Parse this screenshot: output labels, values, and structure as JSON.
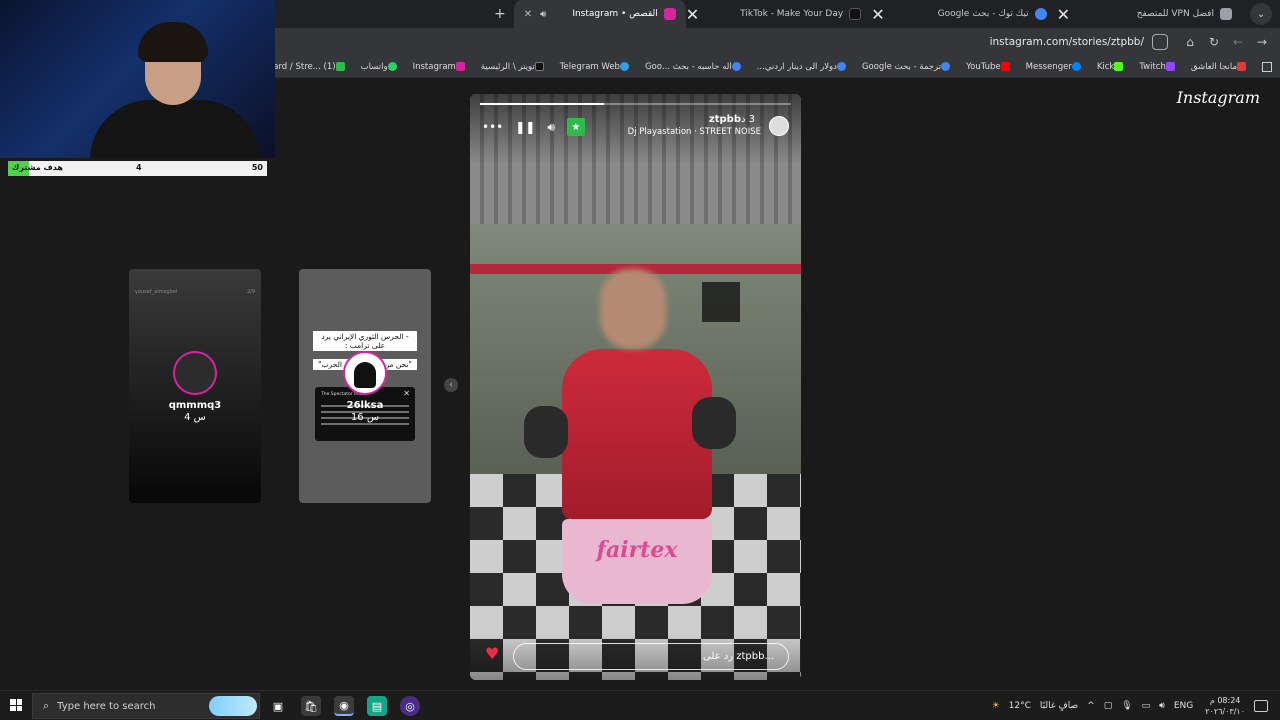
{
  "browser": {
    "tabs": [
      {
        "title": "أفضل VPN للمتصفح",
        "color": "#9aa0a6",
        "active": false
      },
      {
        "title": "تيك توك - بحث Google",
        "color": "#4285f4",
        "active": false
      },
      {
        "title": "TikTok - Make Your Day",
        "color": "#111111",
        "active": false
      },
      {
        "title": "القصص • Instagram",
        "color": "#d6249f",
        "active": true
      }
    ],
    "new_tab_symbol": "+",
    "url": "instagram.com/stories/ztpbb/",
    "bookmarks": [
      {
        "label": "مانجا العاشق",
        "color": "#e03a3a"
      },
      {
        "label": "Twitch",
        "color": "#9146ff"
      },
      {
        "label": "Kick",
        "color": "#53fc18"
      },
      {
        "label": "Messenger",
        "color": "#0084ff"
      },
      {
        "label": "YouTube",
        "color": "#ff0000"
      },
      {
        "label": "ترجمة - بحث Google",
        "color": "#4285f4"
      },
      {
        "label": "دولار الى دينار اردني...",
        "color": "#4285f4"
      },
      {
        "label": "اله حاسبه - بحث ...Goo",
        "color": "#4285f4"
      },
      {
        "label": "Telegram Web",
        "color": "#2aa3e0"
      },
      {
        "label": "تويتر \\ الرئيسية",
        "color": "#111111"
      },
      {
        "label": "Instagram",
        "color": "#d6249f"
      },
      {
        "label": "واتساب",
        "color": "#25d366"
      },
      {
        "label": "Dashboard / Stre... (1)",
        "color": "#2dbb4b"
      }
    ]
  },
  "stream_overlay": {
    "goal_label": "هدف مشترك",
    "current": "4",
    "target": "50",
    "progress": 0.08,
    "bar_color": "#4bd34b"
  },
  "instagram": {
    "logo": "Instagram",
    "stories": [
      {
        "username": "qmmmq3",
        "time": "4 س",
        "header_user": "yousef_almegbel",
        "header_time": "2/9"
      },
      {
        "username": "26lksa",
        "time": "16 س",
        "caption_1": "- الحرس الثوري الإيراني يرد على ترامب :",
        "caption_2": "\"نحن من سيحدد نهاية الحرب\"",
        "tweet_source": "The Spectator Index"
      }
    ],
    "current_story": {
      "username": "ztpbb",
      "time": "3 د",
      "music": "Dj Playastation · STREET NOISE",
      "progress": 0.4,
      "reply_placeholder": "رد على ztpbb...",
      "shorts_brand": "fairtex"
    }
  },
  "taskbar": {
    "search_placeholder": "Type here to search",
    "weather_temp": "12°C",
    "weather_text": "صافٍ غالبًا",
    "language": "ENG",
    "time": "08:24 م",
    "date": "٢٠٢٦/٠٣/١٠"
  }
}
